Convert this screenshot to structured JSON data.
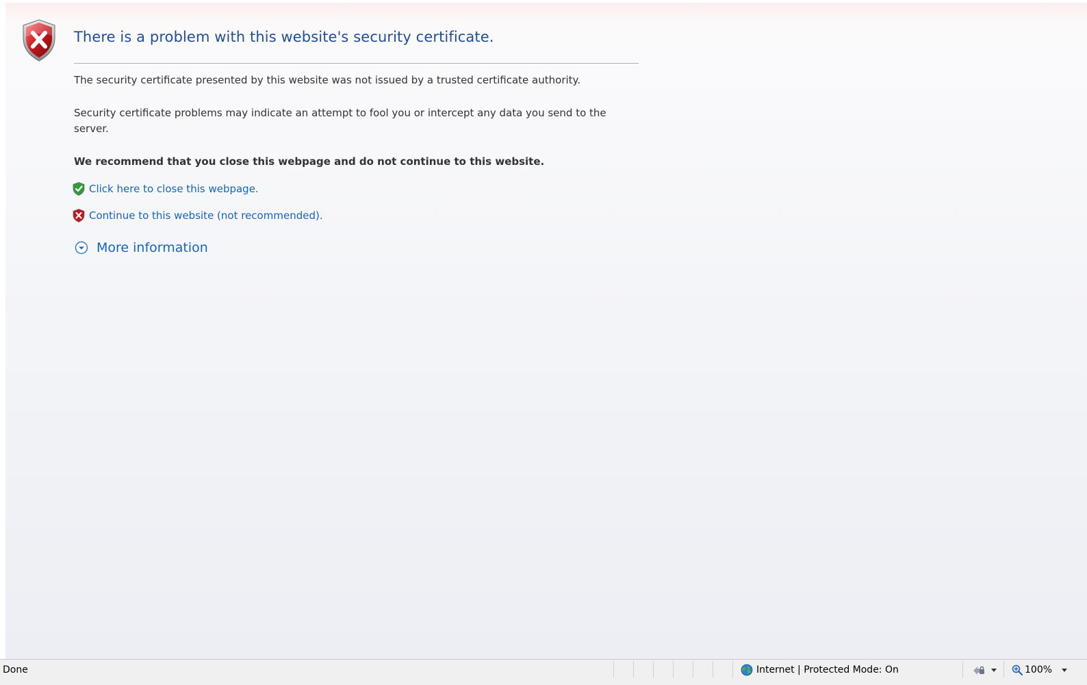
{
  "page": {
    "title": "There is a problem with this website's security certificate.",
    "para1": "The security certificate presented by this website was not issued by a trusted certificate authority.",
    "para2": "Security certificate problems may indicate an attempt to fool you or intercept any data you send to the server.",
    "recommend": "We recommend that you close this webpage and do not continue to this website.",
    "close_link": "Click here to close this webpage.",
    "continue_link": "Continue to this website (not recommended).",
    "more_info": "More information"
  },
  "status": {
    "text": "Done",
    "zone": "Internet | Protected Mode: On",
    "zoom": "100%"
  },
  "colors": {
    "title": "#1f4e9b",
    "link": "#1565c0",
    "shield_red": "#c4161c",
    "shield_green": "#2e9d3a"
  },
  "icons": {
    "main": "red-shield-x-icon",
    "close": "green-shield-check-icon",
    "continue": "red-shield-x-icon",
    "more": "expand-circle-icon",
    "zone": "globe-icon",
    "security": "security-settings-icon",
    "zoom": "zoom-icon"
  }
}
